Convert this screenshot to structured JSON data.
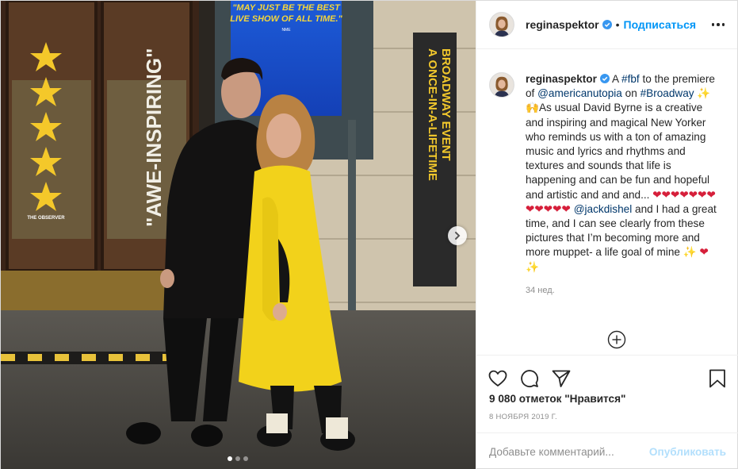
{
  "header": {
    "username": "reginaspektor",
    "separator": "•",
    "follow_label": "Подписаться",
    "more_icon": "more-horizontal-icon"
  },
  "caption": {
    "username": "reginaspektor",
    "text_a": "A ",
    "tag_fbf": "#fbf",
    "text_b": " to the premiere of ",
    "mention_americanutopia": "@americanutopia",
    "text_c": " on ",
    "tag_broadway": "#Broadway",
    "emoji_1": "✨🙌",
    "text_d": "As usual David Byrne is a creative and inspiring and magical New Yorker who reminds us with a ton of amazing music and lyrics and rhythms and textures and sounds that life is happening and can be fun and hopeful and artistic and and and...",
    "hearts": "❤❤❤❤❤❤❤❤❤❤❤❤",
    "mention_jackdishel": "@jackdishel",
    "text_e": " and I had a great time, and I can see clearly from these pictures that I’m becoming more and more muppet- a life goal of mine ",
    "emoji_2": "✨",
    "emoji_3": "❤✨",
    "time": "34 нед."
  },
  "photo": {
    "marquee_line1": "\"MAY JUST BE THE BEST",
    "marquee_line2": "LIVE SHOW OF ALL TIME.\"",
    "marquee_source": "NME",
    "banner_left": "\"AWE-INSPIRING\"",
    "banner_left_source": "THE OBSERVER",
    "banner_right_line1": "A ONCE-IN-A-LIFETIME",
    "banner_right_line2": "BROADWAY EVENT",
    "star_rating": 5,
    "slide_index": 1,
    "slide_count": 3
  },
  "actions": {
    "like_icon": "heart-icon",
    "comment_icon": "comment-icon",
    "share_icon": "send-icon",
    "save_icon": "bookmark-icon",
    "likes_text": "9 080 отметок \"Нравится\"",
    "date": "8 НОЯБРЯ 2019 Г."
  },
  "comment_box": {
    "placeholder": "Добавьте комментарий...",
    "publish_label": "Опубликовать"
  },
  "colors": {
    "accent": "#0095f6",
    "publish_disabled": "#b2dffc",
    "link": "#00376b",
    "muted": "#8e8e8e",
    "coat_yellow": "#f2d21b"
  }
}
